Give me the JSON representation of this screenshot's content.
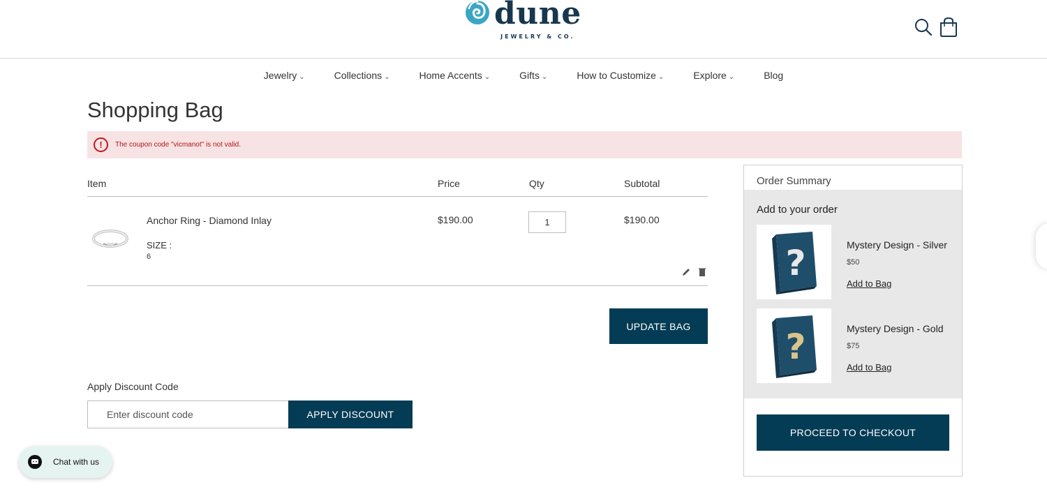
{
  "brand": {
    "name": "dune",
    "tagline": "JEWELRY & CO."
  },
  "nav": {
    "items": [
      {
        "label": "Jewelry",
        "has_caret": true
      },
      {
        "label": "Collections",
        "has_caret": true
      },
      {
        "label": "Home Accents",
        "has_caret": true
      },
      {
        "label": "Gifts",
        "has_caret": true
      },
      {
        "label": "How to Customize",
        "has_caret": true
      },
      {
        "label": "Explore",
        "has_caret": true
      },
      {
        "label": "Blog",
        "has_caret": false
      }
    ],
    "caret": "⌄"
  },
  "page": {
    "title": "Shopping Bag"
  },
  "alert": {
    "message": "The coupon code \"vicmanot\" is not valid.",
    "icon": "!",
    "color": "#c0161c"
  },
  "cart": {
    "headers": {
      "item": "Item",
      "price": "Price",
      "qty": "Qty",
      "subtotal": "Subtotal"
    },
    "items": [
      {
        "name": "Anchor Ring - Diamond Inlay",
        "option_label": "SIZE :",
        "option_value": "6",
        "price": "$190.00",
        "qty": "1",
        "subtotal": "$190.00"
      }
    ],
    "update_label": "UPDATE BAG"
  },
  "discount": {
    "label": "Apply Discount Code",
    "placeholder": "Enter discount code",
    "button_label": "APPLY DISCOUNT"
  },
  "summary": {
    "title": "Order Summary",
    "upsell_title": "Add to your order",
    "products": [
      {
        "name": "Mystery Design - Silver",
        "price": "$50",
        "add_label": "Add to Bag",
        "mark_color": "#e8e8e8"
      },
      {
        "name": "Mystery Design - Gold",
        "price": "$75",
        "add_label": "Add to Bag",
        "mark_color": "#d9c48a"
      }
    ],
    "checkout_label": "PROCEED TO CHECKOUT"
  },
  "chat": {
    "label": "Chat with us"
  },
  "colors": {
    "primary": "#053c55",
    "brand_teal": "#3aa6c4",
    "alert_bg": "#f7e3e4"
  }
}
